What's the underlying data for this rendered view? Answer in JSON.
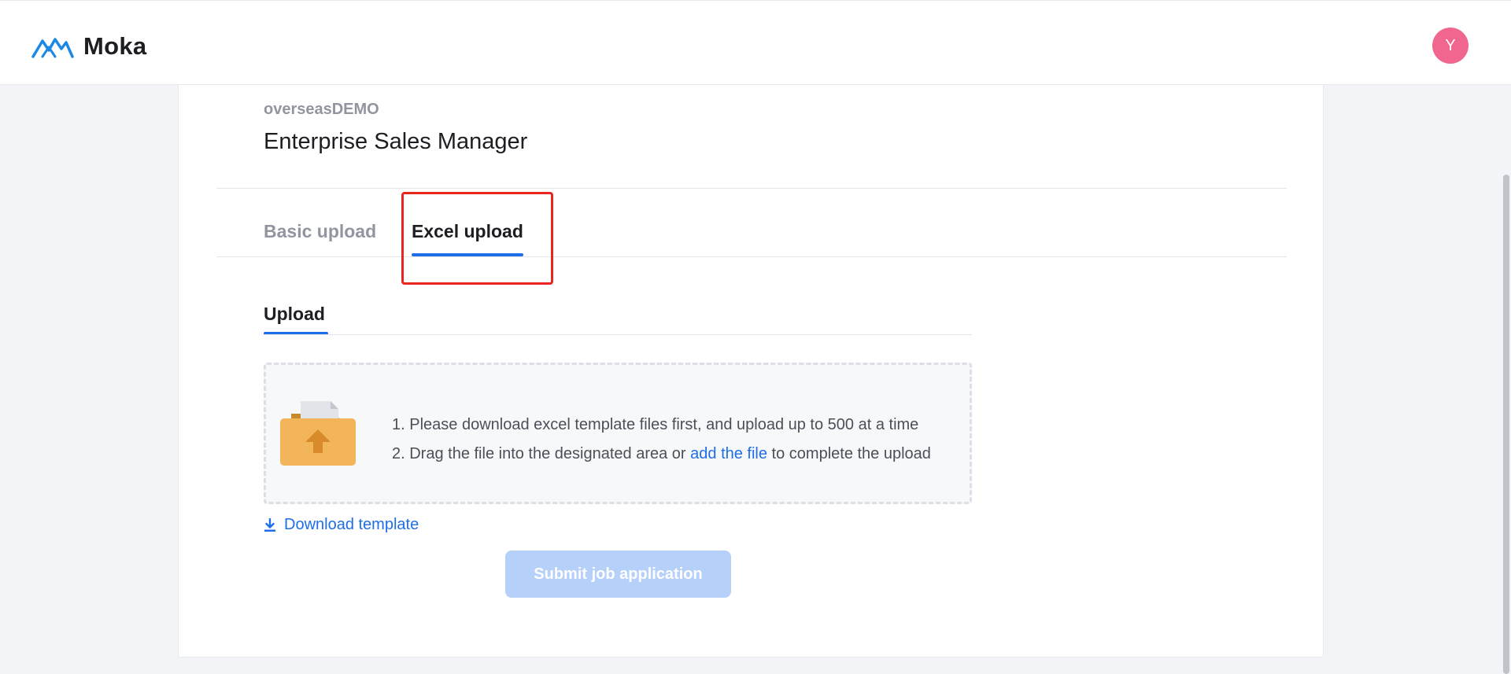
{
  "header": {
    "logo_text": "Moka",
    "logo_icon": "moka-mountain-logo",
    "avatar_initial": "Y",
    "avatar_color": "#f0668e"
  },
  "job": {
    "company": "overseasDEMO",
    "title": "Enterprise Sales Manager"
  },
  "tabs": [
    {
      "label": "Basic upload",
      "active": false
    },
    {
      "label": "Excel upload",
      "active": true
    }
  ],
  "upload_section": {
    "label": "Upload",
    "folder_icon": "folder-upload-icon",
    "instruction_1": "1. Please download excel template files first, and upload up to 500 at a time",
    "instruction_2_before": "2. Drag the file into the designated area or ",
    "instruction_2_link": "add the file",
    "instruction_2_after": " to complete the upload"
  },
  "download": {
    "icon": "download-icon",
    "label": "Download template"
  },
  "submit": {
    "label": "Submit job application",
    "disabled": true
  },
  "colors": {
    "accent": "#1e6ee8",
    "highlight": "#e8251f",
    "submit_disabled": "#b5d0f9"
  }
}
